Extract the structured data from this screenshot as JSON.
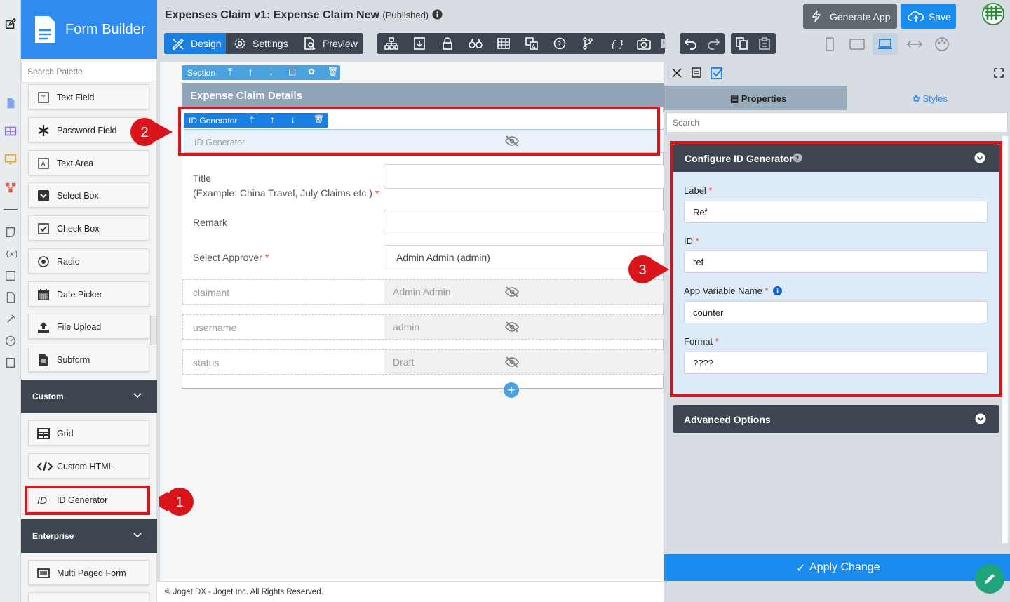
{
  "app": {
    "title": "Expenses Claim v1: Expense Claim New",
    "status": "(Published)",
    "brand": "Form Builder"
  },
  "header": {
    "generate_app": "Generate App",
    "save": "Save",
    "modes": [
      "Design",
      "Settings",
      "Preview"
    ]
  },
  "palette": {
    "search_placeholder": "Search Palette",
    "basic_items": [
      {
        "label": "Text Field",
        "icon": "text-field-icon"
      },
      {
        "label": "Password Field",
        "icon": "asterisk-icon"
      },
      {
        "label": "Text Area",
        "icon": "text-area-icon"
      },
      {
        "label": "Select Box",
        "icon": "select-box-icon"
      },
      {
        "label": "Check Box",
        "icon": "check-box-icon"
      },
      {
        "label": "Radio",
        "icon": "radio-icon"
      },
      {
        "label": "Date Picker",
        "icon": "calendar-icon"
      },
      {
        "label": "File Upload",
        "icon": "upload-icon"
      },
      {
        "label": "Subform",
        "icon": "subform-icon"
      }
    ],
    "custom_category": "Custom",
    "custom_items": [
      {
        "label": "Grid",
        "icon": "grid-icon"
      },
      {
        "label": "Custom HTML",
        "icon": "code-icon"
      },
      {
        "label": "ID Generator",
        "icon": "id-icon",
        "glyph": "ID"
      }
    ],
    "enterprise_category": "Enterprise",
    "enterprise_items": [
      {
        "label": "Multi Paged Form",
        "icon": "multi-page-icon"
      }
    ]
  },
  "canvas": {
    "section_toolbar_label": "Section",
    "section_title": "Expense Claim Details",
    "idgen_toolbar_label": "ID Generator",
    "idgen_field_label": "ID Generator",
    "fields": [
      {
        "label": "Title\n(Example: China Travel, July Claims etc.)",
        "required": true,
        "value": ""
      },
      {
        "label": "Remark",
        "required": false,
        "value": ""
      },
      {
        "label": "Select Approver",
        "required": true,
        "value": "Admin Admin (admin)"
      }
    ],
    "hidden_fields": [
      {
        "label": "claimant",
        "value": "Admin Admin"
      },
      {
        "label": "username",
        "value": "admin"
      },
      {
        "label": "status",
        "value": "Draft"
      }
    ],
    "footer": "© Joget DX - Joget Inc. All Rights Reserved."
  },
  "properties": {
    "tabs": [
      "Properties",
      "Styles"
    ],
    "search_placeholder": "Search",
    "config_title": "Configure ID Generator",
    "fields": [
      {
        "label": "Label",
        "value": "Ref",
        "required": true
      },
      {
        "label": "ID",
        "value": "ref",
        "required": true
      },
      {
        "label": "App Variable Name",
        "value": "counter",
        "required": true
      },
      {
        "label": "Format",
        "value": "????",
        "required": true
      }
    ],
    "advanced": "Advanced Options",
    "apply": "Apply Change"
  },
  "callouts": [
    "1",
    "2",
    "3"
  ],
  "colors": {
    "primary": "#2e8cf0",
    "dark": "#3d4550",
    "callout_red": "#d9141a",
    "panel_light": "#ddeaf8"
  }
}
